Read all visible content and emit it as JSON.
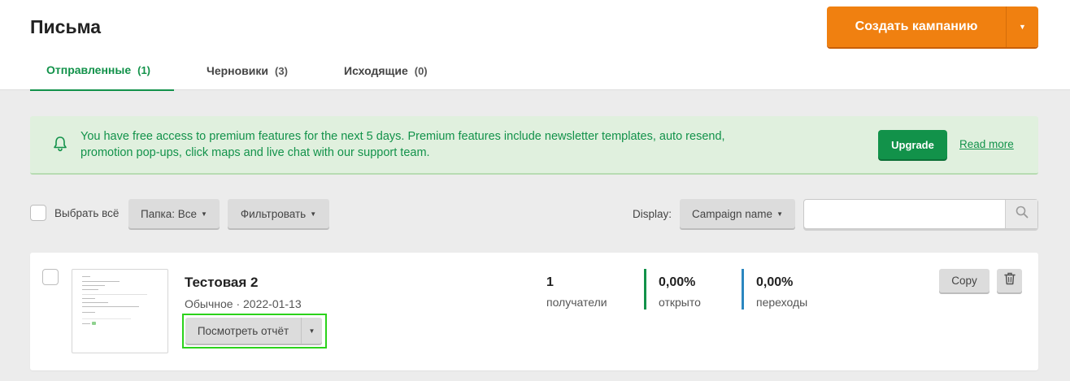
{
  "header": {
    "title": "Письма",
    "create_button": "Создать кампанию",
    "create_caret_icon": "caret-down-icon"
  },
  "tabs": [
    {
      "label": "Отправленные",
      "count": "(1)",
      "active": true
    },
    {
      "label": "Черновики",
      "count": "(3)",
      "active": false
    },
    {
      "label": "Исходящие",
      "count": "(0)",
      "active": false
    }
  ],
  "banner": {
    "icon": "bell-icon",
    "text": "You have free access to premium features for the next 5 days. Premium features include newsletter templates, auto resend, promotion pop-ups, click maps and live chat with our support team.",
    "upgrade_label": "Upgrade",
    "read_more_label": "Read more"
  },
  "toolbar": {
    "select_all_label": "Выбрать всё",
    "folder_label": "Папка: Все",
    "filter_label": "Фильтровать",
    "display_label": "Display:",
    "display_value": "Campaign name",
    "search_value": "",
    "search_icon": "search-icon"
  },
  "campaigns": [
    {
      "name": "Тестовая 2",
      "meta": "Обычное · 2022-01-13",
      "report_label": "Посмотреть отчёт",
      "recipients_value": "1",
      "recipients_label": "получатели",
      "opened_value": "0,00%",
      "opened_label": "открыто",
      "clicks_value": "0,00%",
      "clicks_label": "переходы",
      "copy_label": "Copy",
      "delete_icon": "trash-icon"
    }
  ],
  "colors": {
    "accent_green": "#12924a",
    "accent_orange": "#f08010",
    "clicks_blue": "#2b87c0",
    "banner_bg": "#e0f0de",
    "highlight": "#2bd21b"
  }
}
